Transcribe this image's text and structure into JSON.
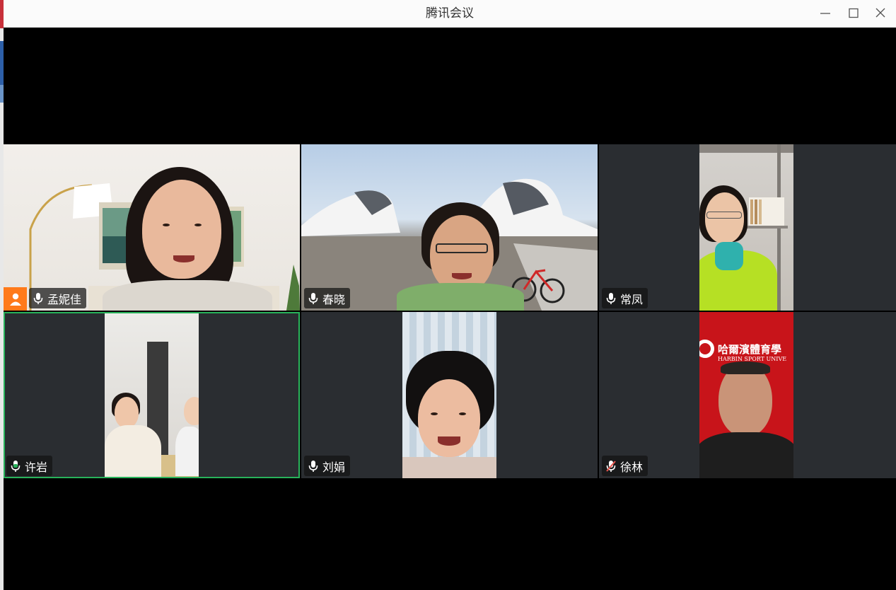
{
  "window": {
    "title": "腾讯会议",
    "controls": [
      "minimize-icon",
      "maximize-icon",
      "close-icon"
    ]
  },
  "participants": [
    {
      "name": "孟妮佳",
      "mic": "on",
      "is_host": true,
      "active_speaker": false
    },
    {
      "name": "春晓",
      "mic": "on",
      "is_host": false,
      "active_speaker": false
    },
    {
      "name": "常凤",
      "mic": "on",
      "is_host": false,
      "active_speaker": false
    },
    {
      "name": "许岩",
      "mic": "on",
      "is_host": false,
      "active_speaker": true
    },
    {
      "name": "刘娟",
      "mic": "on",
      "is_host": false,
      "active_speaker": false
    },
    {
      "name": "徐林",
      "mic": "muted",
      "is_host": false,
      "active_speaker": false
    }
  ],
  "backgrounds": {
    "xulin_banner_cn": "哈爾濱體育學",
    "xulin_banner_en": "HARBIN SPORT UNIVE"
  },
  "colors": {
    "active_border": "#28b25a",
    "host_badge": "#ff7a1a",
    "muted_mic": "#e8544c",
    "tile_bg": "#2a2d31"
  }
}
